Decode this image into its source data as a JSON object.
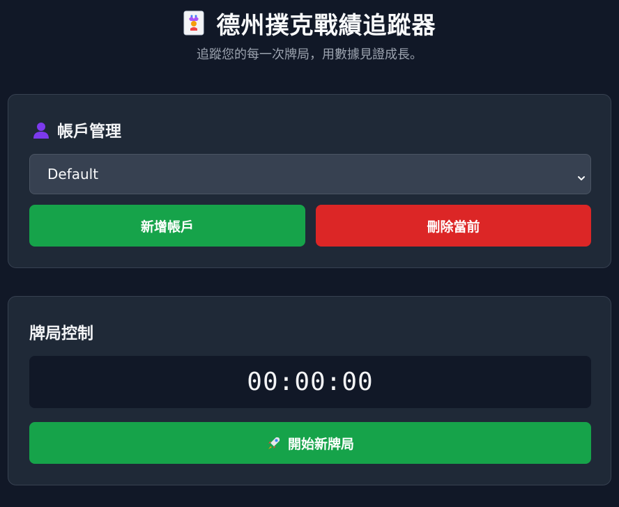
{
  "header": {
    "title": "德州撲克戰績追蹤器",
    "subtitle": "追蹤您的每一次牌局，用數據見證成長。",
    "title_icon": "joker-card-icon"
  },
  "account": {
    "heading": "帳戶管理",
    "heading_icon": "user-silhouette-icon",
    "selected_account": "Default",
    "add_label": "新增帳戶",
    "delete_label": "刪除當前"
  },
  "session": {
    "heading": "牌局控制",
    "timer": "00:00:00",
    "start_label": "開始新牌局",
    "start_icon": "rocket-icon"
  },
  "colors": {
    "background": "#111827",
    "card": "#1f2937",
    "green": "#16a34a",
    "red": "#dc2626"
  }
}
